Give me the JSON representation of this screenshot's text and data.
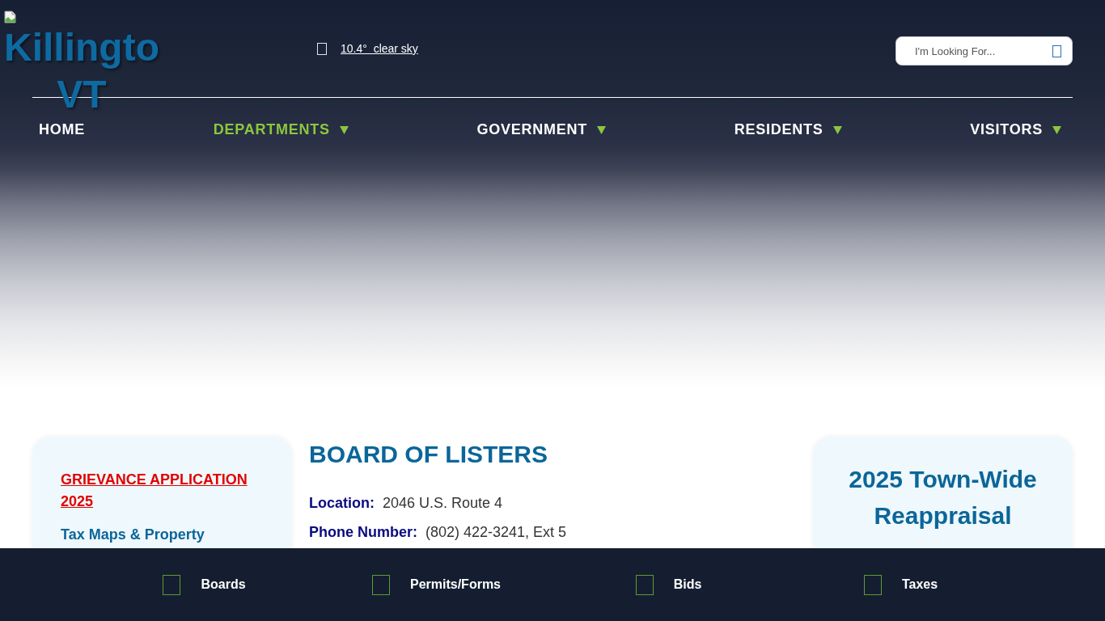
{
  "header": {
    "logo_lines": [
      "Killingto",
      "VT"
    ],
    "weather": {
      "text": "10.4°  clear sky"
    },
    "search": {
      "placeholder": "I'm Looking For..."
    }
  },
  "nav": [
    {
      "label": "HOME",
      "selected": false,
      "dropdown": false
    },
    {
      "label": "DEPARTMENTS",
      "selected": true,
      "dropdown": true
    },
    {
      "label": "GOVERNMENT",
      "selected": false,
      "dropdown": true
    },
    {
      "label": "RESIDENTS",
      "selected": false,
      "dropdown": true
    },
    {
      "label": "VISITORS",
      "selected": false,
      "dropdown": true
    }
  ],
  "sidebar": {
    "links": [
      {
        "kind": "alert",
        "label": "GRIEVANCE APPLICATION 2025"
      },
      {
        "kind": "link",
        "label": "Tax Maps & Property"
      }
    ]
  },
  "main": {
    "title": "BOARD OF LISTERS",
    "details": [
      {
        "label": "Location:",
        "value": "2046 U.S. Route 4"
      },
      {
        "label": "Phone Number:",
        "value": "(802) 422-3241, Ext 5"
      }
    ]
  },
  "aside": {
    "title": "2025 Town-Wide Reappraisal"
  },
  "footer_links": [
    {
      "label": "Boards"
    },
    {
      "label": "Permits/Forms"
    },
    {
      "label": "Bids"
    },
    {
      "label": "Taxes"
    }
  ]
}
